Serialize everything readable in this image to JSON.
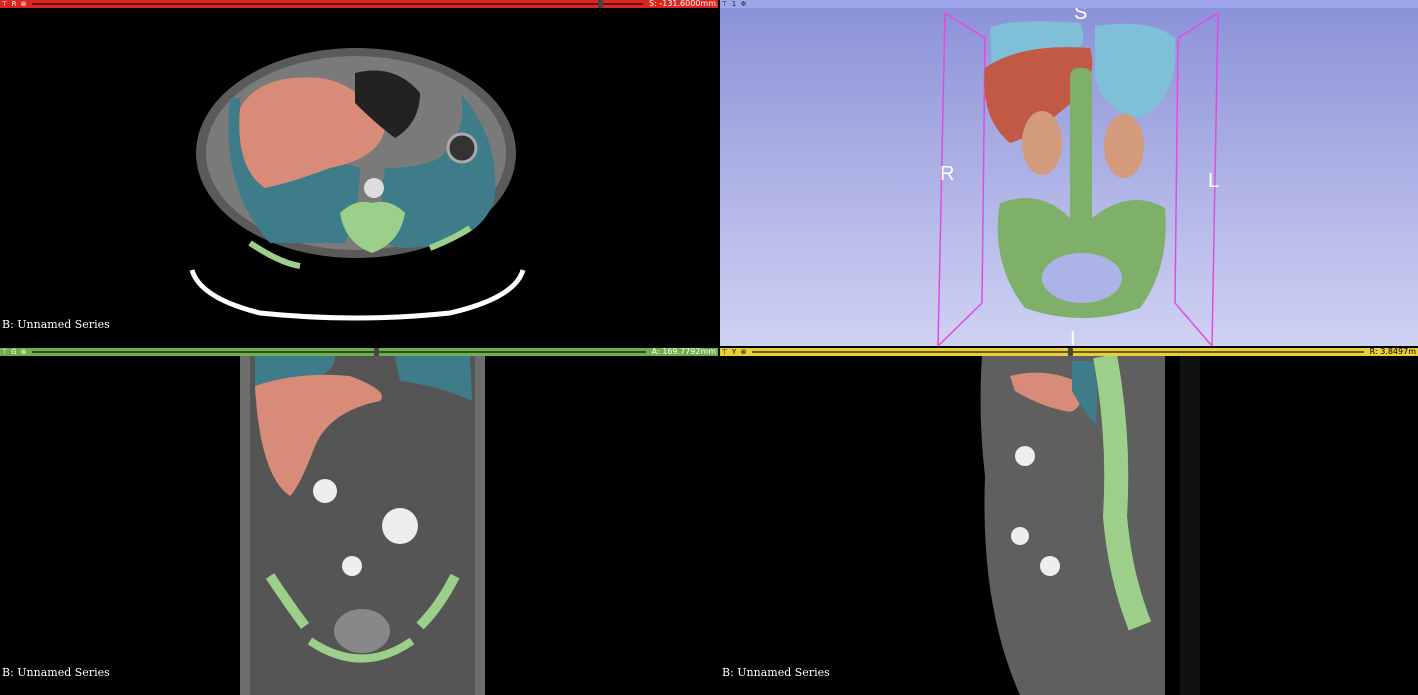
{
  "views": {
    "red": {
      "letter": "R",
      "offset_label": "S: -131.6000mm",
      "slider_pos": 0.93,
      "series": "B: Unnamed Series"
    },
    "threed": {
      "letter": "1",
      "orient": {
        "S": "S",
        "R": "R",
        "L": "L",
        "I": "I"
      }
    },
    "green": {
      "letter": "G",
      "offset_label": "A: 169.7792mm",
      "slider_pos": 0.56,
      "series": "B: Unnamed Series"
    },
    "yellow": {
      "letter": "Y",
      "offset_label": "R: 3.8497m",
      "slider_pos": 0.52,
      "series": "B: Unnamed Series"
    }
  },
  "icons": {
    "pin": "pin-icon",
    "link": "link-icon"
  },
  "colors": {
    "red_bar": "#d9261f",
    "green_bar": "#6eb04a",
    "yellow_bar": "#e9cf3a",
    "threed_bar": "#9da6ea",
    "liver": "#d98b7a",
    "lung": "#3f7c8a",
    "bone": "#9cd08a",
    "kidney": "#c98a6a"
  }
}
